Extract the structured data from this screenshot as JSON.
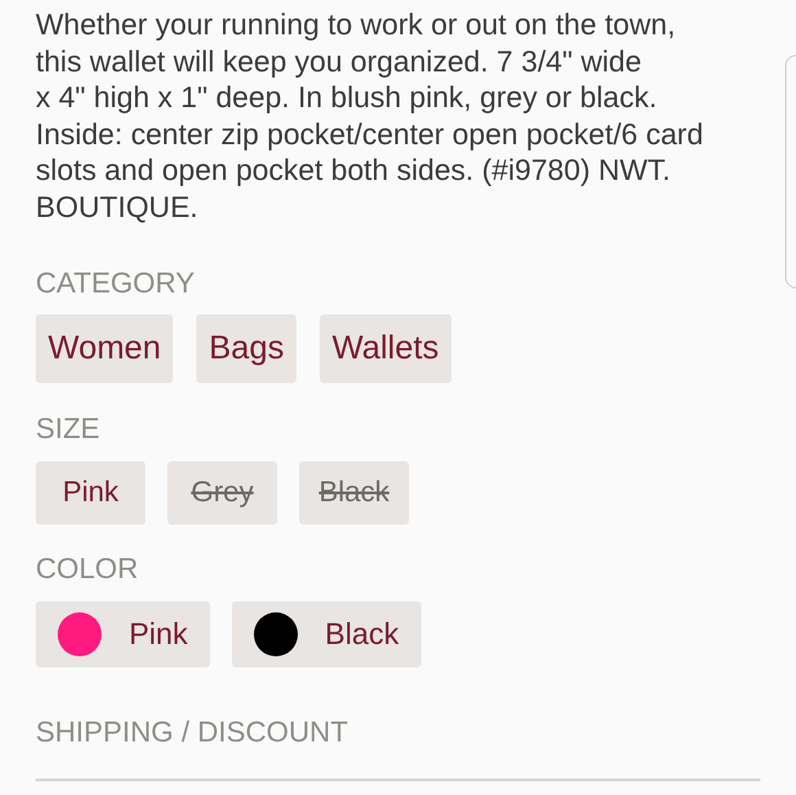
{
  "description": "Whether your running to work or out on the town,\nthis wallet will keep you organized. 7 3/4\" wide\nx 4\" high x 1\" deep. In blush pink, grey or black.\nInside: center zip pocket/center open pocket/6 card\nslots and open pocket both sides. (#i9780) NWT.\nBOUTIQUE.",
  "category": {
    "label": "CATEGORY",
    "items": [
      "Women",
      "Bags",
      "Wallets"
    ]
  },
  "size": {
    "label": "SIZE",
    "items": [
      {
        "label": "Pink",
        "available": true
      },
      {
        "label": "Grey",
        "available": false
      },
      {
        "label": "Black",
        "available": false
      }
    ]
  },
  "color": {
    "label": "COLOR",
    "items": [
      {
        "label": "Pink",
        "color": "#ff1a7f"
      },
      {
        "label": "Black",
        "color": "#000000"
      }
    ]
  },
  "shipping": {
    "label": "SHIPPING / DISCOUNT"
  }
}
